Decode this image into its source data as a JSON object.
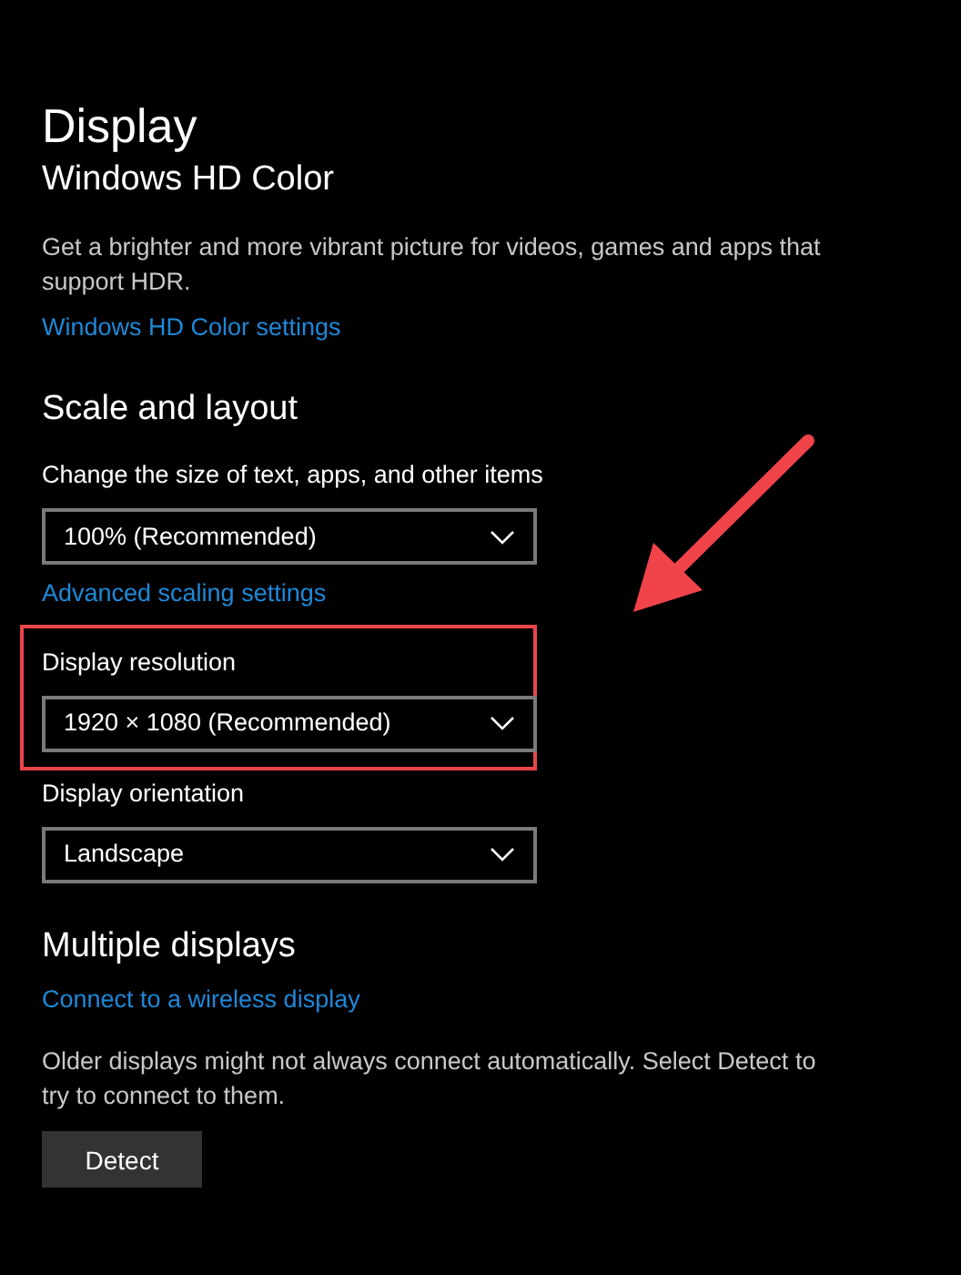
{
  "page_title": "Display",
  "sections": [
    {
      "heading": "Windows HD Color",
      "items": [
        {
          "kind": "text",
          "text": "Get a brighter and more vibrant picture for videos, games and apps that support HDR."
        },
        {
          "kind": "link",
          "text": "Windows HD Color settings"
        }
      ]
    },
    {
      "heading": "Scale and layout",
      "items": [
        {
          "kind": "label",
          "text": "Change the size of text, apps, and other items"
        },
        {
          "kind": "dropdown",
          "value": "100% (Recommended)"
        },
        {
          "kind": "link",
          "text": "Advanced scaling settings"
        },
        {
          "kind": "group",
          "highlighted": true,
          "items": [
            {
              "kind": "label",
              "text": "Display resolution"
            },
            {
              "kind": "dropdown",
              "value": "1920 × 1080 (Recommended)"
            }
          ]
        },
        {
          "kind": "label",
          "text": "Display orientation"
        },
        {
          "kind": "dropdown",
          "value": "Landscape"
        }
      ]
    },
    {
      "heading": "Multiple displays",
      "items": [
        {
          "kind": "link",
          "text": "Connect to a wireless display"
        },
        {
          "kind": "text",
          "text": "Older displays might not always connect automatically. Select Detect to try to connect to them."
        },
        {
          "kind": "button",
          "text": "Detect"
        }
      ]
    }
  ],
  "annotations": [
    {
      "kind": "arrow"
    }
  ]
}
